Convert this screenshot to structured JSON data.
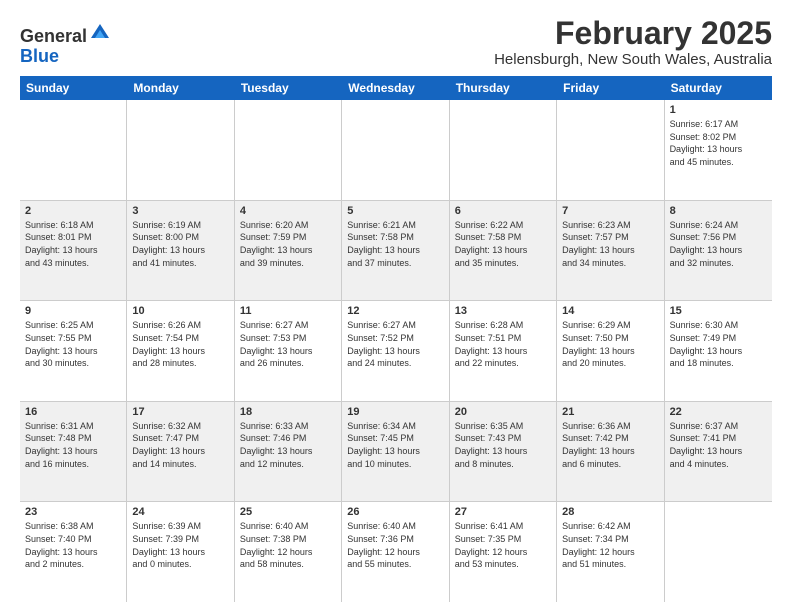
{
  "header": {
    "logo_general": "General",
    "logo_blue": "Blue",
    "month_title": "February 2025",
    "location": "Helensburgh, New South Wales, Australia"
  },
  "weekdays": [
    "Sunday",
    "Monday",
    "Tuesday",
    "Wednesday",
    "Thursday",
    "Friday",
    "Saturday"
  ],
  "weeks": [
    [
      {
        "day": "",
        "info": "",
        "shaded": false
      },
      {
        "day": "",
        "info": "",
        "shaded": false
      },
      {
        "day": "",
        "info": "",
        "shaded": false
      },
      {
        "day": "",
        "info": "",
        "shaded": false
      },
      {
        "day": "",
        "info": "",
        "shaded": false
      },
      {
        "day": "",
        "info": "",
        "shaded": false
      },
      {
        "day": "1",
        "info": "Sunrise: 6:17 AM\nSunset: 8:02 PM\nDaylight: 13 hours\nand 45 minutes.",
        "shaded": false
      }
    ],
    [
      {
        "day": "2",
        "info": "Sunrise: 6:18 AM\nSunset: 8:01 PM\nDaylight: 13 hours\nand 43 minutes.",
        "shaded": true
      },
      {
        "day": "3",
        "info": "Sunrise: 6:19 AM\nSunset: 8:00 PM\nDaylight: 13 hours\nand 41 minutes.",
        "shaded": true
      },
      {
        "day": "4",
        "info": "Sunrise: 6:20 AM\nSunset: 7:59 PM\nDaylight: 13 hours\nand 39 minutes.",
        "shaded": true
      },
      {
        "day": "5",
        "info": "Sunrise: 6:21 AM\nSunset: 7:58 PM\nDaylight: 13 hours\nand 37 minutes.",
        "shaded": true
      },
      {
        "day": "6",
        "info": "Sunrise: 6:22 AM\nSunset: 7:58 PM\nDaylight: 13 hours\nand 35 minutes.",
        "shaded": true
      },
      {
        "day": "7",
        "info": "Sunrise: 6:23 AM\nSunset: 7:57 PM\nDaylight: 13 hours\nand 34 minutes.",
        "shaded": true
      },
      {
        "day": "8",
        "info": "Sunrise: 6:24 AM\nSunset: 7:56 PM\nDaylight: 13 hours\nand 32 minutes.",
        "shaded": true
      }
    ],
    [
      {
        "day": "9",
        "info": "Sunrise: 6:25 AM\nSunset: 7:55 PM\nDaylight: 13 hours\nand 30 minutes.",
        "shaded": false
      },
      {
        "day": "10",
        "info": "Sunrise: 6:26 AM\nSunset: 7:54 PM\nDaylight: 13 hours\nand 28 minutes.",
        "shaded": false
      },
      {
        "day": "11",
        "info": "Sunrise: 6:27 AM\nSunset: 7:53 PM\nDaylight: 13 hours\nand 26 minutes.",
        "shaded": false
      },
      {
        "day": "12",
        "info": "Sunrise: 6:27 AM\nSunset: 7:52 PM\nDaylight: 13 hours\nand 24 minutes.",
        "shaded": false
      },
      {
        "day": "13",
        "info": "Sunrise: 6:28 AM\nSunset: 7:51 PM\nDaylight: 13 hours\nand 22 minutes.",
        "shaded": false
      },
      {
        "day": "14",
        "info": "Sunrise: 6:29 AM\nSunset: 7:50 PM\nDaylight: 13 hours\nand 20 minutes.",
        "shaded": false
      },
      {
        "day": "15",
        "info": "Sunrise: 6:30 AM\nSunset: 7:49 PM\nDaylight: 13 hours\nand 18 minutes.",
        "shaded": false
      }
    ],
    [
      {
        "day": "16",
        "info": "Sunrise: 6:31 AM\nSunset: 7:48 PM\nDaylight: 13 hours\nand 16 minutes.",
        "shaded": true
      },
      {
        "day": "17",
        "info": "Sunrise: 6:32 AM\nSunset: 7:47 PM\nDaylight: 13 hours\nand 14 minutes.",
        "shaded": true
      },
      {
        "day": "18",
        "info": "Sunrise: 6:33 AM\nSunset: 7:46 PM\nDaylight: 13 hours\nand 12 minutes.",
        "shaded": true
      },
      {
        "day": "19",
        "info": "Sunrise: 6:34 AM\nSunset: 7:45 PM\nDaylight: 13 hours\nand 10 minutes.",
        "shaded": true
      },
      {
        "day": "20",
        "info": "Sunrise: 6:35 AM\nSunset: 7:43 PM\nDaylight: 13 hours\nand 8 minutes.",
        "shaded": true
      },
      {
        "day": "21",
        "info": "Sunrise: 6:36 AM\nSunset: 7:42 PM\nDaylight: 13 hours\nand 6 minutes.",
        "shaded": true
      },
      {
        "day": "22",
        "info": "Sunrise: 6:37 AM\nSunset: 7:41 PM\nDaylight: 13 hours\nand 4 minutes.",
        "shaded": true
      }
    ],
    [
      {
        "day": "23",
        "info": "Sunrise: 6:38 AM\nSunset: 7:40 PM\nDaylight: 13 hours\nand 2 minutes.",
        "shaded": false
      },
      {
        "day": "24",
        "info": "Sunrise: 6:39 AM\nSunset: 7:39 PM\nDaylight: 13 hours\nand 0 minutes.",
        "shaded": false
      },
      {
        "day": "25",
        "info": "Sunrise: 6:40 AM\nSunset: 7:38 PM\nDaylight: 12 hours\nand 58 minutes.",
        "shaded": false
      },
      {
        "day": "26",
        "info": "Sunrise: 6:40 AM\nSunset: 7:36 PM\nDaylight: 12 hours\nand 55 minutes.",
        "shaded": false
      },
      {
        "day": "27",
        "info": "Sunrise: 6:41 AM\nSunset: 7:35 PM\nDaylight: 12 hours\nand 53 minutes.",
        "shaded": false
      },
      {
        "day": "28",
        "info": "Sunrise: 6:42 AM\nSunset: 7:34 PM\nDaylight: 12 hours\nand 51 minutes.",
        "shaded": false
      },
      {
        "day": "",
        "info": "",
        "shaded": false
      }
    ]
  ]
}
